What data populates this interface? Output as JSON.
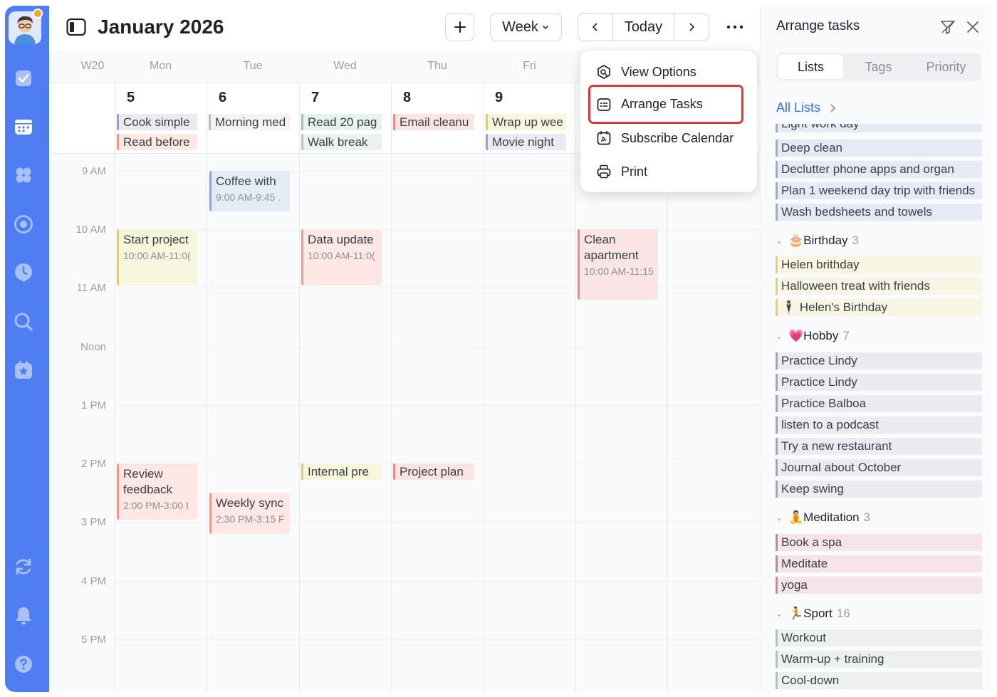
{
  "sidebar": {
    "icons": [
      "avatar",
      "checkbox-icon",
      "calendar-icon",
      "grid-icon",
      "focus-icon",
      "clock-icon",
      "search-icon",
      "star-calendar-icon",
      "sync-icon",
      "bell-icon",
      "help-icon"
    ]
  },
  "header": {
    "month_title": "January 2026",
    "add_label": "+",
    "view_label": "Week",
    "today_label": "Today"
  },
  "calendar": {
    "week_label": "W20",
    "days": [
      {
        "name": "Mon",
        "num": "5"
      },
      {
        "name": "Tue",
        "num": "6"
      },
      {
        "name": "Wed",
        "num": "7"
      },
      {
        "name": "Thu",
        "num": "8"
      },
      {
        "name": "Fri",
        "num": "9"
      }
    ],
    "times": [
      "9 AM",
      "10 AM",
      "11 AM",
      "Noon",
      "1 PM",
      "2 PM",
      "3 PM",
      "4 PM",
      "5 PM"
    ],
    "allday": [
      {
        "text": "Cook simple"
      },
      {
        "text": "Read before"
      },
      {
        "text": "Morning med"
      },
      {
        "text": "Read 20 pag"
      },
      {
        "text": "Walk break"
      },
      {
        "text": "Email cleanu"
      },
      {
        "text": "Wrap up wee"
      },
      {
        "text": "Movie night"
      }
    ],
    "events": [
      {
        "title": "Coffee with",
        "time": "9:00 AM-9:45 ."
      },
      {
        "title": "Start project",
        "time": "10:00 AM-11:0("
      },
      {
        "title": "Data update",
        "time": "10:00 AM-11:0("
      },
      {
        "title": "Clean apartment",
        "time": "10:00 AM-11:15"
      },
      {
        "title": "Review feedback",
        "time": "2:00 PM-3:00 I"
      },
      {
        "title": "Weekly sync",
        "time": "2:30 PM-3:15 F"
      },
      {
        "title": "Internal pre",
        "time": ""
      },
      {
        "title": "Project plan",
        "time": ""
      }
    ]
  },
  "menu": {
    "items": [
      {
        "label": "View Options"
      },
      {
        "label": "Arrange Tasks"
      },
      {
        "label": "Subscribe Calendar"
      },
      {
        "label": "Print"
      }
    ]
  },
  "panel": {
    "title": "Arrange tasks",
    "tabs": [
      "Lists",
      "Tags",
      "Priority"
    ],
    "all_lists": "All Lists",
    "partial_top": "Light work day",
    "tasks_top": [
      "Deep clean",
      "Declutter phone apps and organ",
      "Plan 1 weekend day trip with friends",
      "Wash bedsheets and towels"
    ],
    "groups": [
      {
        "emoji": "🎂",
        "name": "Birthday",
        "count": "3",
        "tasks": [
          "Helen brithday",
          "Halloween treat with friends",
          "🕴 Helen's Birthday"
        ]
      },
      {
        "emoji": "💗",
        "name": "Hobby",
        "count": "7",
        "tasks": [
          "Practice Lindy",
          "Practice Lindy",
          "Practice Balboa",
          "listen to a podcast",
          "Try a new restaurant",
          "Journal about October",
          "Keep swing"
        ]
      },
      {
        "emoji": "🧘",
        "name": "Meditation",
        "count": "3",
        "tasks": [
          "Book a spa",
          "Meditate",
          "yoga"
        ]
      },
      {
        "emoji": "🏃",
        "name": "Sport",
        "count": "16",
        "tasks": [
          "Workout",
          "Warm-up + training",
          "Cool-down"
        ]
      }
    ]
  },
  "colors": {
    "sidebar": "#4f7ef2",
    "accent_link": "#3b6fd8",
    "highlight_border": "#d63a3a"
  }
}
